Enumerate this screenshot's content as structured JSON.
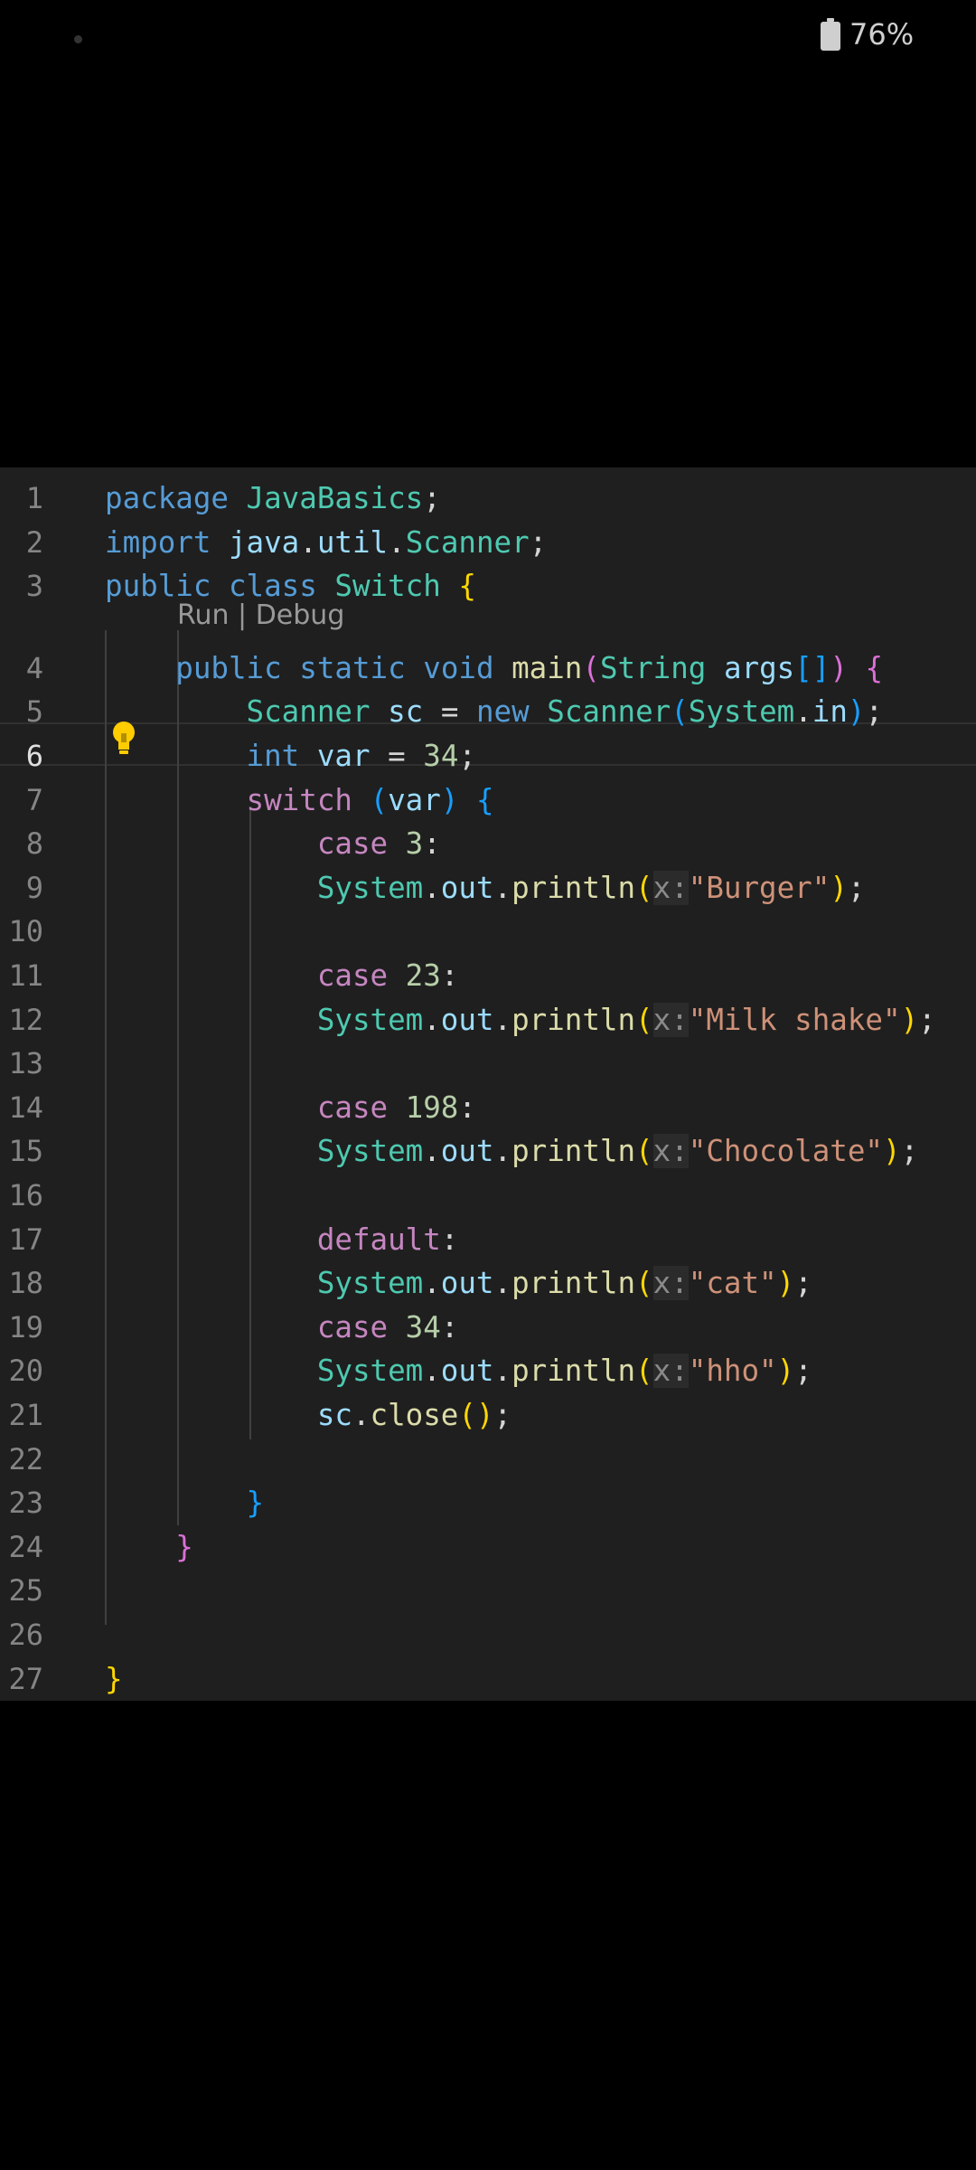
{
  "status": {
    "battery_percent": "76%"
  },
  "editor": {
    "codelens": "Run | Debug",
    "current_line": 6,
    "line_numbers": [
      "1",
      "2",
      "3",
      "4",
      "5",
      "6",
      "7",
      "8",
      "9",
      "10",
      "11",
      "12",
      "13",
      "14",
      "15",
      "16",
      "17",
      "18",
      "19",
      "20",
      "21",
      "22",
      "23",
      "24",
      "25",
      "26",
      "27"
    ],
    "code_lines": [
      "package JavaBasics;",
      "import java.util.Scanner;",
      "public class Switch {",
      "    public static void main(String args[]) {",
      "        Scanner sc = new Scanner(System.in);",
      "        int var = 34;",
      "        switch (var) {",
      "            case 3:",
      "            System.out.println(x:\"Burger\");",
      "",
      "            case 23:",
      "            System.out.println(x:\"Milk shake\");",
      "",
      "            case 198:",
      "            System.out.println(x:\"Chocolate\");",
      "",
      "            default:",
      "            System.out.println(x:\"cat\");",
      "            case 34:",
      "            System.out.println(x:\"hho\");",
      "            sc.close();",
      "",
      "        }",
      "    }",
      "",
      "",
      "}"
    ],
    "colors": {
      "background": "#1f1f1f",
      "keyword": "#569cd6",
      "control": "#c586c0",
      "variable": "#9cdcfe",
      "type": "#4ec9b0",
      "function": "#dcdcaa",
      "number": "#b5cea8",
      "string": "#ce9178",
      "bracket_level1": "#ffd700",
      "bracket_level2": "#da70d6",
      "bracket_level3": "#179fff"
    },
    "icons": [
      "lightbulb-icon",
      "battery-icon"
    ]
  }
}
